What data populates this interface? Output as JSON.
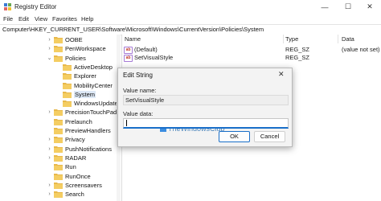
{
  "window": {
    "title": "Registry Editor",
    "controls": {
      "minimize": "—",
      "maximize": "☐",
      "close": "✕"
    }
  },
  "menu": [
    "File",
    "Edit",
    "View",
    "Favorites",
    "Help"
  ],
  "address": "Computer\\HKEY_CURRENT_USER\\Software\\Microsoft\\Windows\\CurrentVersion\\Policies\\System",
  "tree": {
    "items": [
      {
        "label": "OOBE",
        "state": "collapsed"
      },
      {
        "label": "PenWorkspace",
        "state": "collapsed"
      },
      {
        "label": "Policies",
        "state": "expanded"
      },
      {
        "label": "ActiveDesktop",
        "state": "leaf"
      },
      {
        "label": "Explorer",
        "state": "leaf"
      },
      {
        "label": "MobilityCenter",
        "state": "leaf"
      },
      {
        "label": "System",
        "state": "selected"
      },
      {
        "label": "WindowsUpdate",
        "state": "leaf"
      },
      {
        "label": "PrecisionTouchPad",
        "state": "collapsed"
      },
      {
        "label": "Prelaunch",
        "state": "leaf"
      },
      {
        "label": "PreviewHandlers",
        "state": "leaf"
      },
      {
        "label": "Privacy",
        "state": "collapsed"
      },
      {
        "label": "PushNotifications",
        "state": "collapsed"
      },
      {
        "label": "RADAR",
        "state": "collapsed"
      },
      {
        "label": "Run",
        "state": "leaf"
      },
      {
        "label": "RunOnce",
        "state": "leaf"
      },
      {
        "label": "Screensavers",
        "state": "collapsed"
      },
      {
        "label": "Search",
        "state": "collapsed"
      }
    ]
  },
  "list": {
    "columns": {
      "name": "Name",
      "type": "Type",
      "data": "Data"
    },
    "rows": [
      {
        "name": "(Default)",
        "type": "REG_SZ",
        "data": "(value not set)",
        "icon": "string-value-icon"
      },
      {
        "name": "SetVisualStyle",
        "type": "REG_SZ",
        "data": "",
        "icon": "string-value-icon"
      }
    ]
  },
  "dialog": {
    "title": "Edit String",
    "close": "✕",
    "value_name_label": "Value name:",
    "value_name": "SetVisualStyle",
    "value_data_label": "Value data:",
    "value_data": "",
    "ok": "OK",
    "cancel": "Cancel"
  },
  "watermark": "TheWindowsClub",
  "colors": {
    "folder": "#e8b84a",
    "accent": "#1a6fc9",
    "selection": "#dde8f5"
  }
}
